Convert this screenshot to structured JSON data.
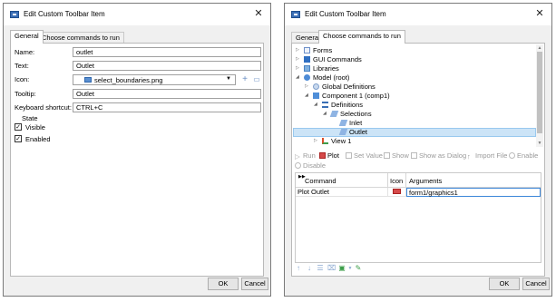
{
  "left_dialog": {
    "title": "Edit Custom Toolbar Item",
    "tabs": [
      "General",
      "Choose commands to run"
    ],
    "fields": {
      "name": {
        "label": "Name:",
        "value": "outlet"
      },
      "text": {
        "label": "Text:",
        "value": "Outlet"
      },
      "icon": {
        "label": "Icon:",
        "value": "select_boundaries.png"
      },
      "tooltip": {
        "label": "Tooltip:",
        "value": "Outlet"
      },
      "shortcut": {
        "label": "Keyboard shortcut:",
        "value": "CTRL+C"
      }
    },
    "state": {
      "title": "State",
      "visible_label": "Visible",
      "enabled_label": "Enabled",
      "visible": true,
      "enabled": true
    },
    "ok": "OK",
    "cancel": "Cancel"
  },
  "right_dialog": {
    "title": "Edit Custom Toolbar Item",
    "tabs": [
      "General",
      "Choose commands to run"
    ],
    "tree": [
      {
        "label": "Forms",
        "icon": "forms-icon"
      },
      {
        "label": "GUI Commands",
        "icon": "gui-commands-icon"
      },
      {
        "label": "Libraries",
        "icon": "libraries-icon"
      },
      {
        "label": "Model (root)",
        "icon": "model-icon"
      },
      {
        "label": "Global Definitions",
        "icon": "global-definitions-icon"
      },
      {
        "label": "Component 1 (comp1)",
        "icon": "component-icon"
      },
      {
        "label": "Definitions",
        "icon": "definitions-icon"
      },
      {
        "label": "Selections",
        "icon": "selections-icon"
      },
      {
        "label": "Inlet",
        "icon": "selection-icon"
      },
      {
        "label": "Outlet",
        "icon": "selection-icon"
      },
      {
        "label": "View 1",
        "icon": "view-icon"
      }
    ],
    "toolbar": {
      "run": "Run",
      "plot": "Plot",
      "set_value": "Set Value",
      "show": "Show",
      "show_as_dialog": "Show as Dialog",
      "import_file": "Import File",
      "enable": "Enable",
      "disable": "Disable"
    },
    "grid": {
      "columns": [
        "Command",
        "Icon",
        "Arguments"
      ],
      "rows": [
        {
          "command": "Plot Outlet",
          "icon": "plot-icon",
          "arguments": "form1/graphics1"
        }
      ]
    },
    "ok": "OK",
    "cancel": "Cancel"
  },
  "colors": {
    "selection": "#cce4f7",
    "dialog_bg": "#f0f0f0"
  }
}
